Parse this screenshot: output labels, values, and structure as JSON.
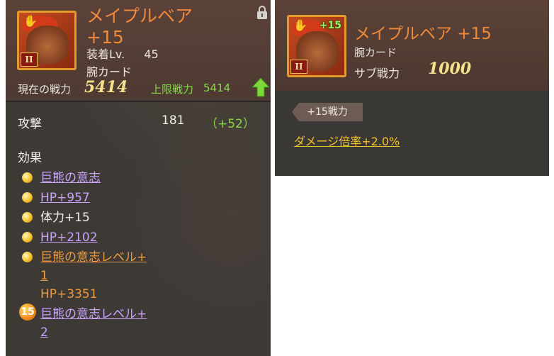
{
  "left_panel": {
    "item_name": "メイプルベア",
    "item_level": "+15",
    "equip_label": "装着Lv.",
    "equip_value": "45",
    "card_type": "腕カード",
    "rank_numeral": "II",
    "current_power_label": "現在の戦力",
    "current_power_value": "5414",
    "limit_power_label": "上限戦力",
    "limit_power_value": "5414",
    "stat_name": "攻撃",
    "stat_value": "181",
    "stat_bonus": "（+52）",
    "effects_title": "効果",
    "effects": [
      {
        "text": "巨熊の意志",
        "style": "purple"
      },
      {
        "text": "HP+957",
        "style": "purple"
      },
      {
        "text": "体力+15",
        "style": "white"
      },
      {
        "text": "HP+2102",
        "style": "purple"
      },
      {
        "text": "巨熊の意志レベル+",
        "style": "orange"
      },
      {
        "text": "1",
        "style": "orange"
      },
      {
        "text": "HP+3351",
        "style": "orange-plain"
      },
      {
        "text": "巨熊の意志レベル+",
        "style": "purple"
      },
      {
        "text": "2",
        "style": "purple"
      }
    ],
    "badge_level": "15"
  },
  "right_panel": {
    "item_name": "メイプルベア +15",
    "plus_badge": "+15",
    "rank_numeral": "II",
    "card_type": "腕カード",
    "sub_power_label": "サブ戦力",
    "sub_power_value": "1000",
    "power_tag": "+15戦力",
    "damage_bonus": "ダメージ倍率+2.0%"
  },
  "colors": {
    "panel_bg": "#3d3a36",
    "header_bg": "#5b4238",
    "title_orange": "#f0883a",
    "power_gold": "#f5e28a",
    "green": "#86d94a",
    "purple_link": "#c9a3ff",
    "orange_link": "#f09a3f",
    "damage_gold": "#f2c22e"
  }
}
